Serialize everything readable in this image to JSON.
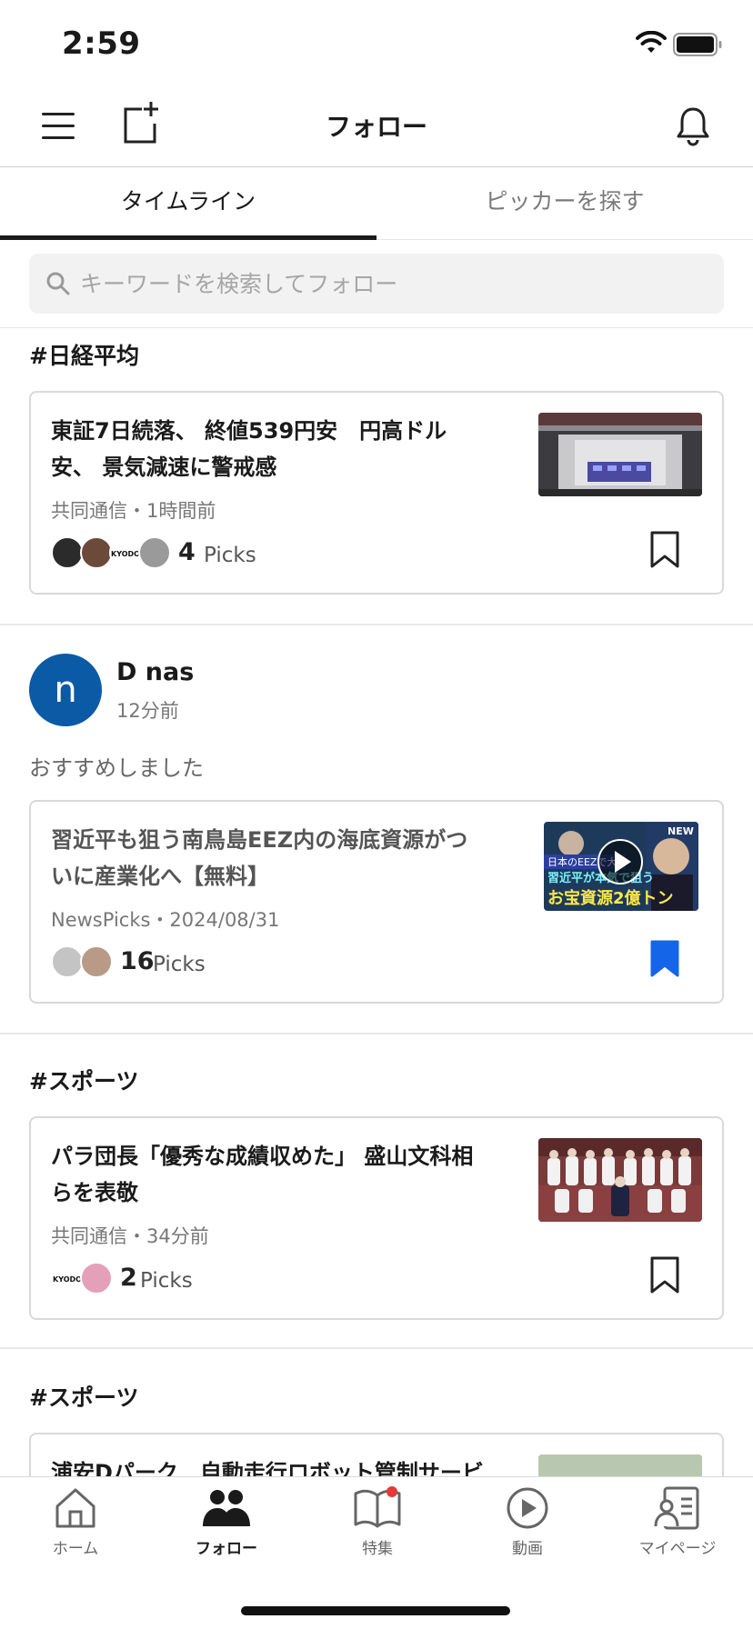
{
  "status_bar": {
    "time": "2:59"
  },
  "header": {
    "title": "フォロー"
  },
  "tabs": [
    {
      "label": "タイムライン",
      "active": true
    },
    {
      "label": "ピッカーを探す",
      "active": false
    }
  ],
  "search": {
    "placeholder": "キーワードを検索してフォロー"
  },
  "sections": [
    {
      "heading": "#日経平均",
      "article": {
        "title": "東証7日続落、 終値539円安　円高ドル安、 景気減速に警戒感",
        "meta": "共同通信・1時間前",
        "picks_count": "4",
        "picks_label": "Picks",
        "bookmarked": false,
        "avatar_badge": "KYODO"
      }
    },
    {
      "user": {
        "avatar_letter": "n",
        "name": "D nas",
        "time": "12分前",
        "comment": "おすすめしました"
      },
      "article": {
        "title": "習近平も狙う南鳥島EEZ内の海底資源がついに産業化へ【無料】",
        "meta": "NewsPicks・2024/08/31",
        "picks_count": "16",
        "picks_label": "Picks",
        "bookmarked": true,
        "thumb_text": {
          "line1": "日本のEEZで大",
          "line2": "習近平が本気で狙う",
          "line3": "お宝資源2億トン",
          "corner": "NEW"
        }
      }
    },
    {
      "heading": "#スポーツ",
      "article": {
        "title": "パラ団長「優秀な成績収めた」 盛山文科相らを表敬",
        "meta": "共同通信・34分前",
        "picks_count": "2",
        "picks_label": "Picks",
        "bookmarked": false,
        "avatar_badge": "KYODO"
      }
    },
    {
      "heading": "#スポーツ",
      "article": {
        "title": "浦安Dパーク　自動走行ロボット管制サービ"
      }
    }
  ],
  "tab_bar": [
    {
      "label": "ホーム",
      "icon": "home-icon",
      "active": false
    },
    {
      "label": "フォロー",
      "icon": "people-icon",
      "active": true
    },
    {
      "label": "特集",
      "icon": "book-icon",
      "active": false,
      "badge": true
    },
    {
      "label": "動画",
      "icon": "play-icon",
      "active": false
    },
    {
      "label": "マイページ",
      "icon": "profile-icon",
      "active": false
    }
  ],
  "colors": {
    "accent_blue": "#1565e8",
    "avatar_blue": "#0b5aa6",
    "badge_red": "#e53935",
    "text_primary": "#1a1a1a",
    "text_muted": "#777777"
  }
}
